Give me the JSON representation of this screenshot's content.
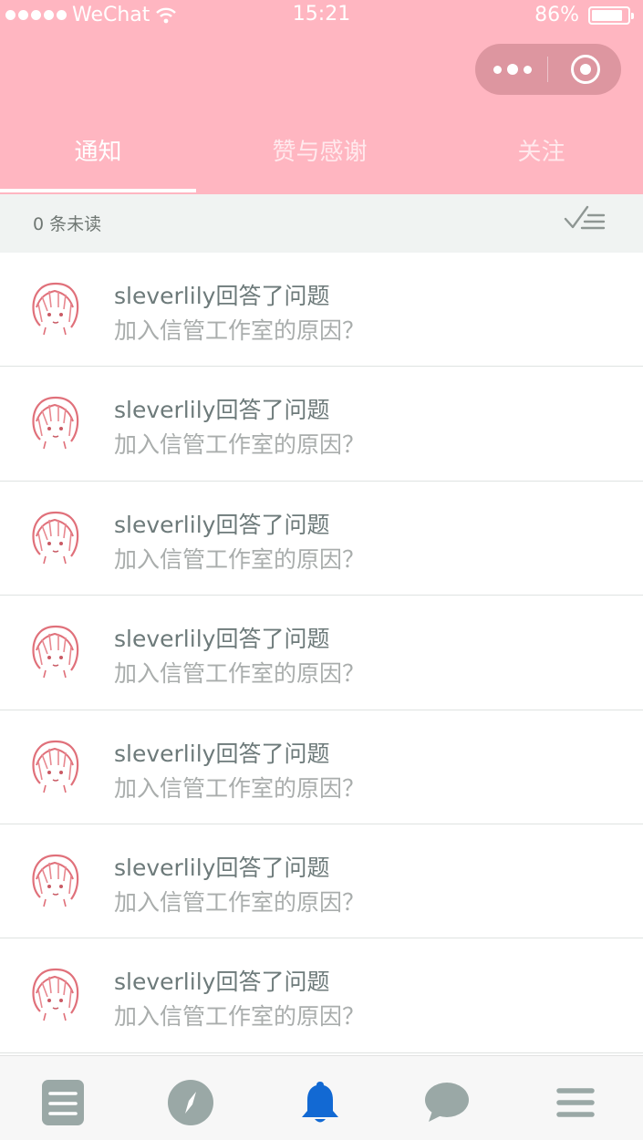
{
  "status_bar": {
    "carrier": "WeChat",
    "time": "15:21",
    "battery": "86%",
    "battery_level": 0.86
  },
  "tabs": [
    {
      "label": "通知",
      "active": true
    },
    {
      "label": "赞与感谢",
      "active": false
    },
    {
      "label": "关注",
      "active": false
    }
  ],
  "unread": {
    "text": "0 条未读",
    "mark_read_icon": "check-list-icon"
  },
  "notifications": [
    {
      "title": "sleverlily回答了问题",
      "subtitle": "加入信管工作室的原因？"
    },
    {
      "title": "sleverlily回答了问题",
      "subtitle": "加入信管工作室的原因？"
    },
    {
      "title": "sleverlily回答了问题",
      "subtitle": "加入信管工作室的原因？"
    },
    {
      "title": "sleverlily回答了问题",
      "subtitle": "加入信管工作室的原因？"
    },
    {
      "title": "sleverlily回答了问题",
      "subtitle": "加入信管工作室的原因？"
    },
    {
      "title": "sleverlily回答了问题",
      "subtitle": "加入信管工作室的原因？"
    },
    {
      "title": "sleverlily回答了问题",
      "subtitle": "加入信管工作室的原因？"
    }
  ],
  "bottom_nav": [
    {
      "icon": "list-icon",
      "active": false
    },
    {
      "icon": "compass-icon",
      "active": false
    },
    {
      "icon": "bell-icon",
      "active": true
    },
    {
      "icon": "chat-bubble-icon",
      "active": false
    },
    {
      "icon": "menu-icon",
      "active": false
    }
  ],
  "colors": {
    "header": "#ffb6c1",
    "active_nav": "#1269d3",
    "inactive_nav": "#9aa8a6",
    "avatar_stroke": "#e0707a"
  }
}
